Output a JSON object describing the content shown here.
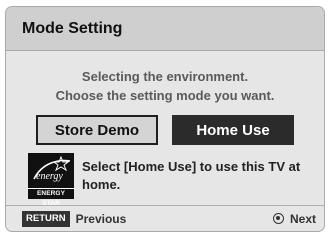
{
  "dialog": {
    "title": "Mode Setting",
    "message_line1": "Selecting the environment.",
    "message_line2": "Choose the setting mode you want.",
    "buttons": {
      "store_demo": "Store Demo",
      "home_use": "Home Use"
    },
    "info_text": "Select [Home Use] to use this TV at home.",
    "logo_label": "ENERGY STAR",
    "logo_script": "energy"
  },
  "footer": {
    "return_key": "RETURN",
    "previous": "Previous",
    "next": "Next"
  },
  "colors": {
    "selected_button_bg": "#2b2b2b",
    "dialog_bg": "#e6e6e6",
    "header_bg": "#cfcfcf"
  }
}
